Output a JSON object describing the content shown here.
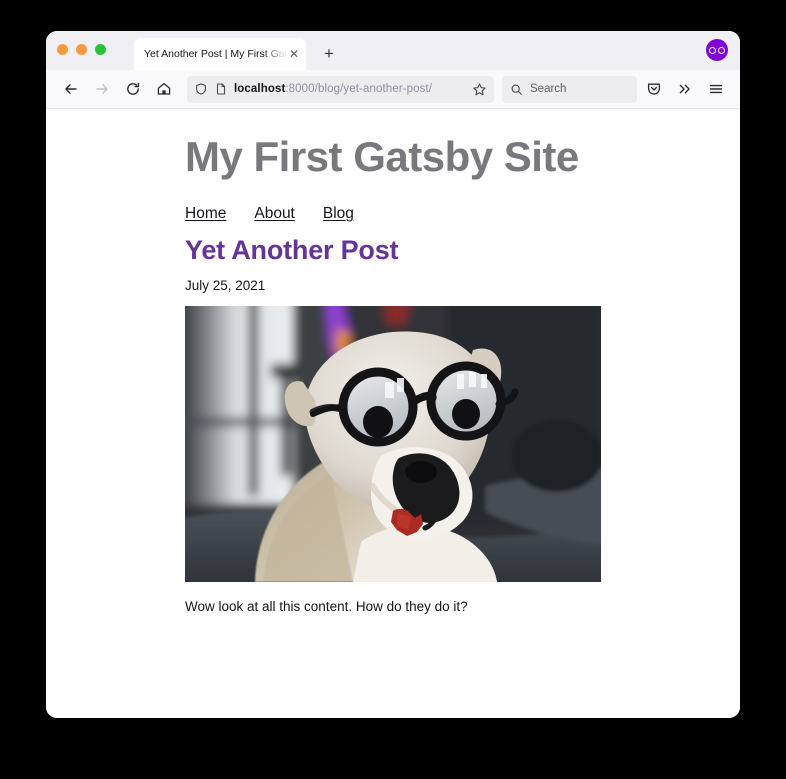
{
  "window": {
    "traffic_lights": [
      {
        "name": "close",
        "color": "#f89a3d"
      },
      {
        "name": "minimize",
        "color": "#f89a3d"
      },
      {
        "name": "zoom",
        "color": "#2ac13b"
      }
    ]
  },
  "tabs": [
    {
      "title": "Yet Another Post | My First Gatsby S",
      "close_label": "✕",
      "active": true
    }
  ],
  "tabstrip": {
    "new_tab_label": "+",
    "account_icon": "account-avatar-icon",
    "accent_color": "#8000d7"
  },
  "toolbar": {
    "back_icon": "back-arrow-icon",
    "forward_icon": "forward-arrow-icon",
    "reload_icon": "reload-icon",
    "home_icon": "home-icon",
    "shield_icon": "shield-icon",
    "page_icon": "page-info-icon",
    "bookmark_icon": "star-icon",
    "pocket_icon": "pocket-icon",
    "overflow_icon": "double-chevron-icon",
    "menu_icon": "hamburger-menu-icon",
    "url": {
      "host": "localhost",
      "path": ":8000/blog/yet-another-post/",
      "full": "localhost:8000/blog/yet-another-post/"
    },
    "search": {
      "placeholder": "Search",
      "icon": "search-icon"
    }
  },
  "page": {
    "site_title": "My First Gatsby Site",
    "nav": [
      {
        "label": "Home"
      },
      {
        "label": "About"
      },
      {
        "label": "Blog"
      }
    ],
    "post": {
      "title": "Yet Another Post",
      "date": "July 25, 2021",
      "image_alt": "Boxer dog wearing round black googly-eye novelty glasses",
      "body": "Wow look at all this content. How do they do it?"
    },
    "colors": {
      "site_title": "#78787d",
      "post_title": "#663399",
      "body_text": "#15141a"
    }
  }
}
